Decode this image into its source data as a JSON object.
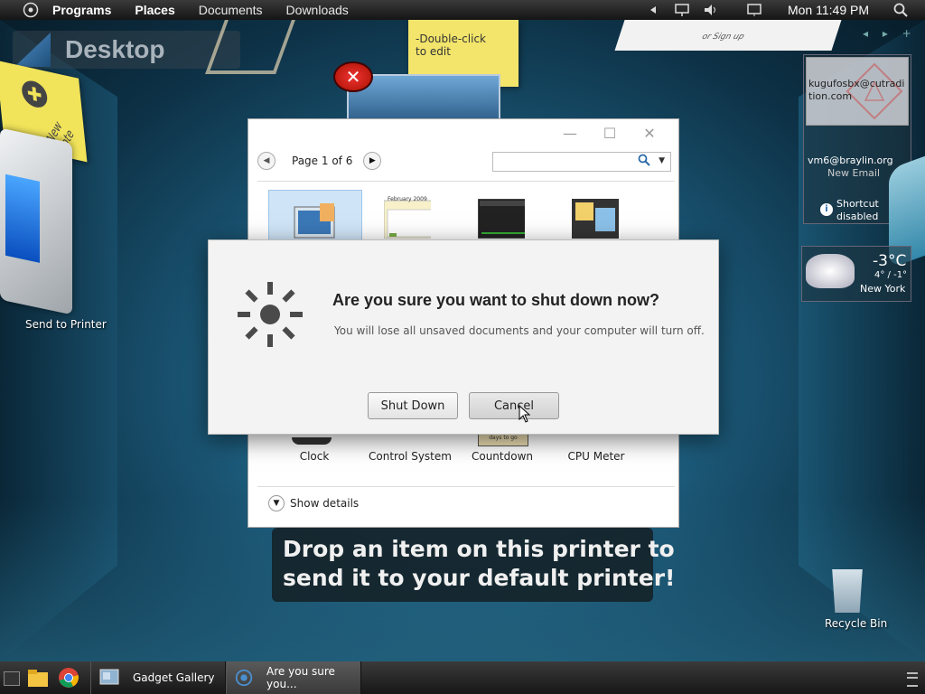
{
  "topbar": {
    "menus": [
      "Programs",
      "Places",
      "Documents",
      "Downloads"
    ],
    "clock": "Mon 11:49 PM"
  },
  "desktop": {
    "label": "Desktop",
    "sticky_note_text": "New note",
    "sticky_edit_line1": "-Double-click",
    "sticky_edit_line2": "to edit",
    "signup_text": "or Sign up",
    "printer_label": "Send to Printer",
    "recycle_label": "Recycle Bin"
  },
  "email_widget": {
    "top_email": "kugufosbx@cutradition.com",
    "email": "vm6@braylin.org",
    "status": "New Email",
    "shortcut_line1": "Shortcut",
    "shortcut_line2": "disabled"
  },
  "weather": {
    "temp": "-3°C",
    "range": "4° / -1°",
    "city": "New York"
  },
  "gallery": {
    "page_label": "Page 1 of 6",
    "search_placeholder": "",
    "items": [
      "Clock",
      "Control System",
      "Countdown",
      "CPU Meter"
    ],
    "calendar_header": "February 2009",
    "countdown_caption": "days to go",
    "show_details": "Show details"
  },
  "dialog": {
    "title": "Are you sure you want to shut down now?",
    "message": "You will lose all unsaved documents and your computer will turn off.",
    "shutdown_label": "Shut Down",
    "cancel_label": "Cancel"
  },
  "tooltip": {
    "line1": "Drop an item on this printer to",
    "line2": "send it to your default printer!"
  },
  "taskbar": {
    "tasks": [
      "Gadget Gallery",
      "Are you sure you..."
    ]
  }
}
